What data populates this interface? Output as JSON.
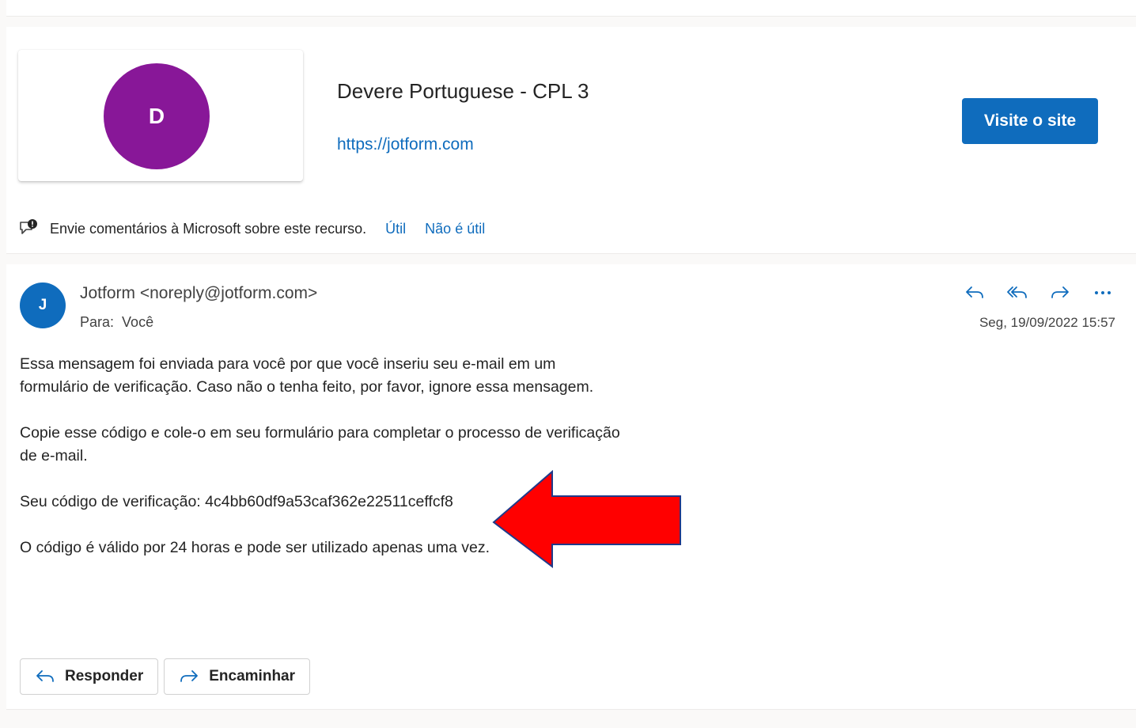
{
  "sender_card": {
    "logo_letter": "D",
    "name": "Devere Portuguese - CPL 3",
    "url": "https://jotform.com",
    "visit_button": "Visite o site",
    "logo_color": "#881798"
  },
  "feedback": {
    "icon": "feedback-icon",
    "text": "Envie comentários à Microsoft sobre este recurso.",
    "helpful": "Útil",
    "not_helpful": "Não é útil"
  },
  "message": {
    "avatar_letter": "J",
    "from": "Jotform <noreply@jotform.com>",
    "to_label": "Para:",
    "to_value": "Você",
    "date": "Seg, 19/09/2022 15:57",
    "actions": [
      "reply-icon",
      "reply-all-icon",
      "forward-icon",
      "more-icon"
    ],
    "paragraphs": [
      "Essa mensagem foi enviada para você por que você inseriu seu e-mail em um formulário de verificação. Caso não o tenha feito, por favor, ignore essa mensagem.",
      "Copie esse código e cole-o em seu formulário para completar o processo de verificação de e-mail.",
      "Seu código de verificação: 4c4bb60df9a53caf362e22511ceffcf8",
      "O código é válido por 24 horas e pode ser utilizado apenas uma vez."
    ],
    "reply_button": "Responder",
    "forward_button": "Encaminhar"
  },
  "colors": {
    "accent": "#0f6cbd",
    "annotation_arrow": "#ff0000"
  }
}
